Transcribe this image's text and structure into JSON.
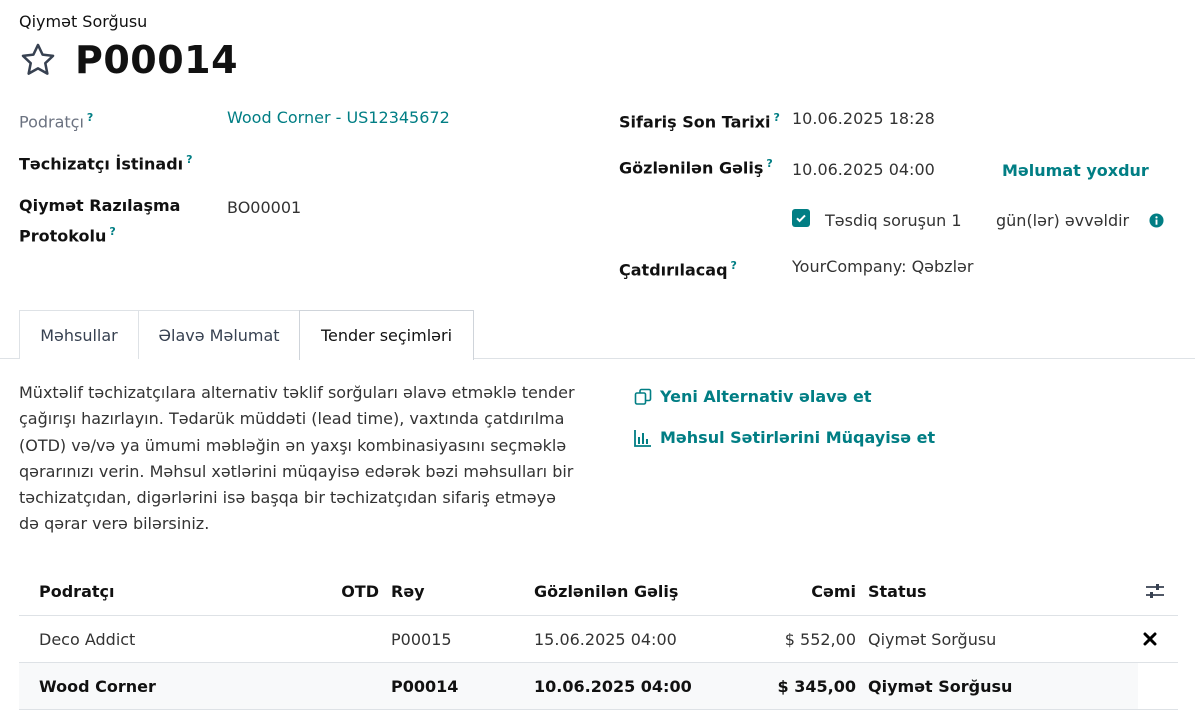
{
  "breadcrumb": "Qiymət Sorğusu",
  "title": "P00014",
  "fields": {
    "vendor_label": "Podratçı",
    "vendor_value": "Wood Corner - US12345672",
    "vendor_ref_label": "Təchizatçı İstinadı",
    "agreement_label_line1": "Qiymət Razılaşma",
    "agreement_label_line2": "Protokolu",
    "agreement_value": "BO00001",
    "order_deadline_label": "Sifariş Son Tarixi",
    "order_deadline_value": "10.06.2025 18:28",
    "expected_arrival_label": "Gözlənilən Gəliş",
    "expected_arrival_value": "10.06.2025 04:00",
    "no_info": "Məlumat yoxdur",
    "confirm_label": "Təsdiq soruşun 1",
    "confirm_suffix": "gün(lər) əvvəldir",
    "deliver_to_label": "Çatdırılacaq",
    "deliver_to_value": "YourCompany: Qəbzlər",
    "help_mark": "?"
  },
  "tabs": [
    {
      "label": "Məhsullar",
      "active": false
    },
    {
      "label": "Əlavə Məlumat",
      "active": false
    },
    {
      "label": "Tender seçimləri",
      "active": true
    }
  ],
  "description": "Müxtəlif təchizatçılara alternativ təklif sorğuları əlavə etməklə tender çağırışı hazırlayın. Tədarük müddəti (lead time), vaxtında çatdırılma (OTD) və/və ya ümumi məbləğin ən yaxşı kombinasiyasını seçməklə qərarınızı verin. Məhsul xətlərini müqayisə edərək bəzi məhsulları bir təchizatçıdan, digərlərini isə başqa bir təchizatçıdan sifariş etməyə də qərar verə bilərsiniz.",
  "actions": {
    "add_alternative": "Yeni Alternativ əlavə et",
    "compare_lines": "Məhsul Sətirlərini Müqayisə et"
  },
  "table": {
    "headers": {
      "vendor": "Podratçı",
      "otd": "OTD",
      "ref": "Rəy",
      "expected": "Gözlənilən Gəliş",
      "total": "Cəmi",
      "status": "Status"
    },
    "rows": [
      {
        "vendor": "Deco Addict",
        "otd": "",
        "ref": "P00015",
        "expected": "15.06.2025 04:00",
        "total": "$ 552,00",
        "status": "Qiymət Sorğusu",
        "current": false
      },
      {
        "vendor": "Wood Corner",
        "otd": "",
        "ref": "P00014",
        "expected": "10.06.2025 04:00",
        "total": "$ 345,00",
        "status": "Qiymət Sorğusu",
        "current": true
      }
    ]
  },
  "colors": {
    "accent": "#017e84",
    "text": "#111111",
    "muted": "#6b7280",
    "border": "#dee2e6"
  },
  "icons": {
    "favorite": "star-outline-icon",
    "checkbox": "check-icon",
    "info": "info-circle-icon",
    "add_alternative": "copy-icon",
    "compare": "bar-chart-icon",
    "settings": "sliders-icon",
    "remove": "close-icon"
  }
}
